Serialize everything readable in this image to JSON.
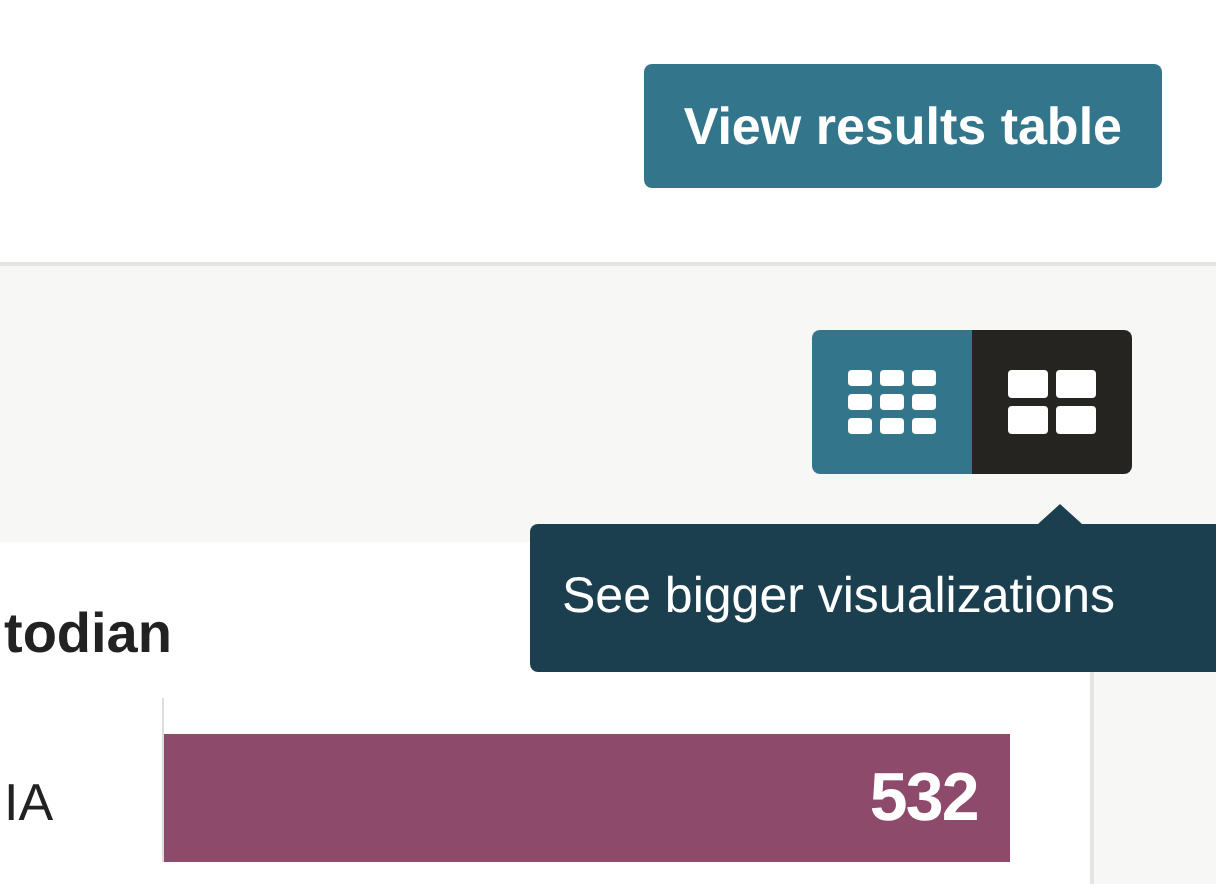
{
  "header": {
    "button": "View results table"
  },
  "view_toggle": [
    {
      "kind": "small",
      "selected": false
    },
    {
      "kind": "large",
      "selected": true
    }
  ],
  "tooltip": "See bigger visualizations",
  "card": {
    "title": "todian",
    "rows": [
      {
        "label": "IA",
        "value": "532"
      }
    ]
  }
}
